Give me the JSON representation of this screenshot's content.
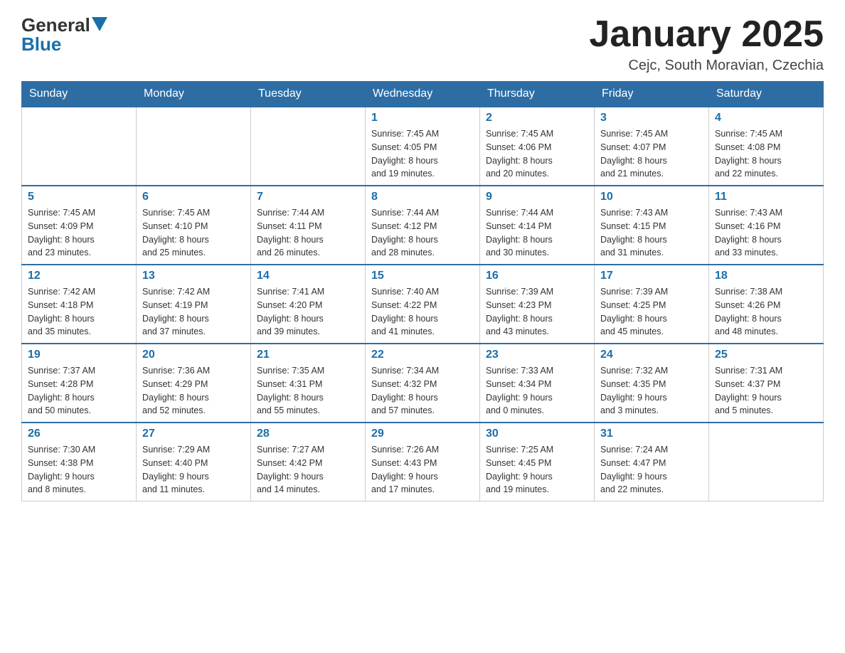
{
  "header": {
    "logo": {
      "general": "General",
      "blue": "Blue",
      "triangle": "▲"
    },
    "title": "January 2025",
    "subtitle": "Cejc, South Moravian, Czechia"
  },
  "days_of_week": [
    "Sunday",
    "Monday",
    "Tuesday",
    "Wednesday",
    "Thursday",
    "Friday",
    "Saturday"
  ],
  "weeks": [
    {
      "days": [
        {
          "number": "",
          "info": ""
        },
        {
          "number": "",
          "info": ""
        },
        {
          "number": "",
          "info": ""
        },
        {
          "number": "1",
          "info": "Sunrise: 7:45 AM\nSunset: 4:05 PM\nDaylight: 8 hours\nand 19 minutes."
        },
        {
          "number": "2",
          "info": "Sunrise: 7:45 AM\nSunset: 4:06 PM\nDaylight: 8 hours\nand 20 minutes."
        },
        {
          "number": "3",
          "info": "Sunrise: 7:45 AM\nSunset: 4:07 PM\nDaylight: 8 hours\nand 21 minutes."
        },
        {
          "number": "4",
          "info": "Sunrise: 7:45 AM\nSunset: 4:08 PM\nDaylight: 8 hours\nand 22 minutes."
        }
      ]
    },
    {
      "days": [
        {
          "number": "5",
          "info": "Sunrise: 7:45 AM\nSunset: 4:09 PM\nDaylight: 8 hours\nand 23 minutes."
        },
        {
          "number": "6",
          "info": "Sunrise: 7:45 AM\nSunset: 4:10 PM\nDaylight: 8 hours\nand 25 minutes."
        },
        {
          "number": "7",
          "info": "Sunrise: 7:44 AM\nSunset: 4:11 PM\nDaylight: 8 hours\nand 26 minutes."
        },
        {
          "number": "8",
          "info": "Sunrise: 7:44 AM\nSunset: 4:12 PM\nDaylight: 8 hours\nand 28 minutes."
        },
        {
          "number": "9",
          "info": "Sunrise: 7:44 AM\nSunset: 4:14 PM\nDaylight: 8 hours\nand 30 minutes."
        },
        {
          "number": "10",
          "info": "Sunrise: 7:43 AM\nSunset: 4:15 PM\nDaylight: 8 hours\nand 31 minutes."
        },
        {
          "number": "11",
          "info": "Sunrise: 7:43 AM\nSunset: 4:16 PM\nDaylight: 8 hours\nand 33 minutes."
        }
      ]
    },
    {
      "days": [
        {
          "number": "12",
          "info": "Sunrise: 7:42 AM\nSunset: 4:18 PM\nDaylight: 8 hours\nand 35 minutes."
        },
        {
          "number": "13",
          "info": "Sunrise: 7:42 AM\nSunset: 4:19 PM\nDaylight: 8 hours\nand 37 minutes."
        },
        {
          "number": "14",
          "info": "Sunrise: 7:41 AM\nSunset: 4:20 PM\nDaylight: 8 hours\nand 39 minutes."
        },
        {
          "number": "15",
          "info": "Sunrise: 7:40 AM\nSunset: 4:22 PM\nDaylight: 8 hours\nand 41 minutes."
        },
        {
          "number": "16",
          "info": "Sunrise: 7:39 AM\nSunset: 4:23 PM\nDaylight: 8 hours\nand 43 minutes."
        },
        {
          "number": "17",
          "info": "Sunrise: 7:39 AM\nSunset: 4:25 PM\nDaylight: 8 hours\nand 45 minutes."
        },
        {
          "number": "18",
          "info": "Sunrise: 7:38 AM\nSunset: 4:26 PM\nDaylight: 8 hours\nand 48 minutes."
        }
      ]
    },
    {
      "days": [
        {
          "number": "19",
          "info": "Sunrise: 7:37 AM\nSunset: 4:28 PM\nDaylight: 8 hours\nand 50 minutes."
        },
        {
          "number": "20",
          "info": "Sunrise: 7:36 AM\nSunset: 4:29 PM\nDaylight: 8 hours\nand 52 minutes."
        },
        {
          "number": "21",
          "info": "Sunrise: 7:35 AM\nSunset: 4:31 PM\nDaylight: 8 hours\nand 55 minutes."
        },
        {
          "number": "22",
          "info": "Sunrise: 7:34 AM\nSunset: 4:32 PM\nDaylight: 8 hours\nand 57 minutes."
        },
        {
          "number": "23",
          "info": "Sunrise: 7:33 AM\nSunset: 4:34 PM\nDaylight: 9 hours\nand 0 minutes."
        },
        {
          "number": "24",
          "info": "Sunrise: 7:32 AM\nSunset: 4:35 PM\nDaylight: 9 hours\nand 3 minutes."
        },
        {
          "number": "25",
          "info": "Sunrise: 7:31 AM\nSunset: 4:37 PM\nDaylight: 9 hours\nand 5 minutes."
        }
      ]
    },
    {
      "days": [
        {
          "number": "26",
          "info": "Sunrise: 7:30 AM\nSunset: 4:38 PM\nDaylight: 9 hours\nand 8 minutes."
        },
        {
          "number": "27",
          "info": "Sunrise: 7:29 AM\nSunset: 4:40 PM\nDaylight: 9 hours\nand 11 minutes."
        },
        {
          "number": "28",
          "info": "Sunrise: 7:27 AM\nSunset: 4:42 PM\nDaylight: 9 hours\nand 14 minutes."
        },
        {
          "number": "29",
          "info": "Sunrise: 7:26 AM\nSunset: 4:43 PM\nDaylight: 9 hours\nand 17 minutes."
        },
        {
          "number": "30",
          "info": "Sunrise: 7:25 AM\nSunset: 4:45 PM\nDaylight: 9 hours\nand 19 minutes."
        },
        {
          "number": "31",
          "info": "Sunrise: 7:24 AM\nSunset: 4:47 PM\nDaylight: 9 hours\nand 22 minutes."
        },
        {
          "number": "",
          "info": ""
        }
      ]
    }
  ]
}
